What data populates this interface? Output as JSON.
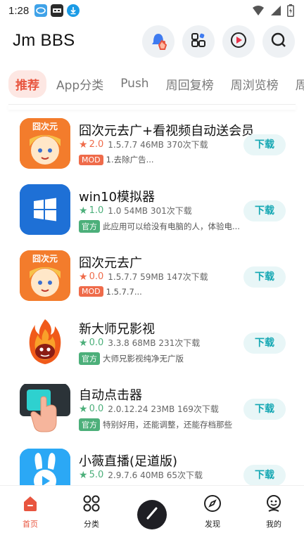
{
  "status_bar": {
    "time": "1:28",
    "icons": [
      "app-notification-icon",
      "app-notification-icon-2",
      "download-icon",
      "wifi-icon",
      "signal-icon",
      "battery-icon"
    ]
  },
  "header": {
    "title": "Jm BBS",
    "buttons": [
      "notification-bell-icon",
      "apps-icon",
      "video-play-icon",
      "search-icon"
    ]
  },
  "tabs": [
    "推荐",
    "App分类",
    "Push",
    "周回复榜",
    "周浏览榜",
    "周"
  ],
  "active_tab": 0,
  "apps": [
    {
      "name": "囧次元去广+看视频自动送会员",
      "rating": "2.0",
      "rating_color": "#ef6b4a",
      "version": "1.5.7.7",
      "size": "46MB",
      "downloads": "370次下载",
      "badge": "MOD",
      "badge_type": "mod",
      "desc": "1.去除广告...",
      "icon": "jiongciyuan-icon",
      "button": "下载"
    },
    {
      "name": "win10模拟器",
      "rating": "1.0",
      "rating_color": "#4caf7a",
      "version": "1.0",
      "size": "54MB",
      "downloads": "301次下载",
      "badge": "官方",
      "badge_type": "official",
      "desc": "此应用可以给没有电脑的人，体验电...",
      "icon": "windows-logo-icon",
      "button": "下载"
    },
    {
      "name": "囧次元去广",
      "rating": "0.0",
      "rating_color": "#ef6b4a",
      "version": "1.5.7.7",
      "size": "59MB",
      "downloads": "147次下载",
      "badge": "MOD",
      "badge_type": "mod",
      "desc": "1.5.7.7...",
      "icon": "jiongciyuan-icon",
      "button": "下载"
    },
    {
      "name": "新大师兄影视",
      "rating": "0.0",
      "rating_color": "#4caf7a",
      "version": "3.3.8",
      "size": "68MB",
      "downloads": "231次下载",
      "badge": "官方",
      "badge_type": "official",
      "desc": "大师兄影视纯净无广版",
      "icon": "fire-monkey-icon",
      "button": "下载"
    },
    {
      "name": "自动点击器",
      "rating": "0.0",
      "rating_color": "#4caf7a",
      "version": "2.0.12.24",
      "size": "23MB",
      "downloads": "169次下载",
      "badge": "官方",
      "badge_type": "official",
      "desc": "特别好用，还能调整，还能存档那些",
      "icon": "auto-clicker-icon",
      "button": "下载"
    },
    {
      "name": "小薇直播(足道版)",
      "rating": "5.0",
      "rating_color": "#4caf7a",
      "version": "2.9.7.6",
      "size": "40MB",
      "downloads": "65次下载",
      "badge": "",
      "badge_type": "",
      "desc": "",
      "icon": "rabbit-play-icon",
      "button": "下载"
    }
  ],
  "bottom_nav": [
    {
      "label": "首页",
      "icon": "home-icon"
    },
    {
      "label": "分类",
      "icon": "grid-icon"
    },
    {
      "label": "",
      "icon": "pen-icon"
    },
    {
      "label": "发现",
      "icon": "compass-icon"
    },
    {
      "label": "我的",
      "icon": "profile-icon"
    }
  ],
  "colors": {
    "accent": "#e8553f",
    "download_bg": "#e8f6f7",
    "download_text": "#14a7b3",
    "mod": "#ef6b4a",
    "official": "#4caf7a"
  }
}
